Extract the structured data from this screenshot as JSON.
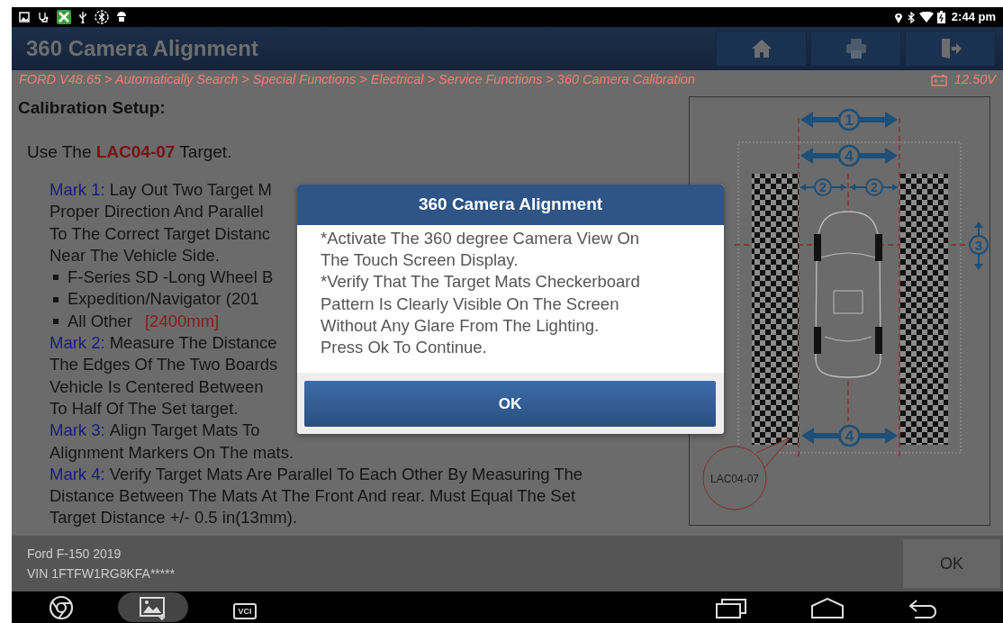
{
  "status_bar": {
    "time": "2:44 pm"
  },
  "header": {
    "title": "360 Camera Alignment",
    "buttons": [
      {
        "kind": "home"
      },
      {
        "kind": "print"
      },
      {
        "kind": "exit"
      }
    ]
  },
  "breadcrumb": {
    "path": "FORD V48.65 > Automatically Search > Special Functions > Electrical > Service Functions > 360 Camera Calibration",
    "voltage": "12.50V"
  },
  "content": {
    "heading": "Calibration Setup:",
    "intro": "Use The **LAC04-07** Target.",
    "lines": [
      {
        "kind": "mark",
        "label": "Mark 1:",
        "text": "Lay Out Two Target M"
      },
      {
        "kind": "text",
        "text": "Proper Direction And Parallel"
      },
      {
        "kind": "text",
        "text": "To The Correct Target Distanc"
      },
      {
        "kind": "text",
        "text": "Near The Vehicle Side."
      },
      {
        "kind": "bullet",
        "text": "F-Series SD -Long Wheel B"
      },
      {
        "kind": "bullet",
        "text": "Expedition/Navigator (201"
      },
      {
        "kind": "bullet",
        "text": "All Other",
        "value": "[2400mm]"
      },
      {
        "kind": "mark",
        "label": "Mark 2:",
        "text": "Measure The Distance"
      },
      {
        "kind": "text",
        "text": "The Edges Of The Two Boards"
      },
      {
        "kind": "text",
        "text": "Vehicle Is Centered Between"
      },
      {
        "kind": "text",
        "text": "To Half Of The Set target."
      },
      {
        "kind": "mark",
        "label": "Mark 3:",
        "text": "Align Target Mats To"
      },
      {
        "kind": "text",
        "text": "Alignment Markers On The mats."
      },
      {
        "kind": "mark",
        "label": "Mark 4:",
        "text": "Verify Target Mats Are Parallel To Each Other By Measuring The"
      },
      {
        "kind": "text",
        "text": "Distance Between The Mats At The Front And rear. Must Equal The Set"
      },
      {
        "kind": "text",
        "text": "Target Distance +/- 0.5 in(13mm)."
      }
    ]
  },
  "diagram": {
    "width_mark": "1",
    "outer_mark": "4",
    "half_marks": [
      "2",
      "2"
    ],
    "side_mark": "3",
    "rear_mark": "4",
    "target_label": "LAC04-07"
  },
  "dialog": {
    "title": "360 Camera Alignment",
    "lines": [
      "*Activate The 360 degree Camera View On",
      "The Touch Screen Display.",
      "*Verify That The Target Mats Checkerboard",
      "Pattern Is Clearly Visible On The Screen",
      "Without Any Glare From The Lighting.",
      "Press Ok To Continue."
    ],
    "button": "OK"
  },
  "footer": {
    "vehicle": "Ford F-150 2019",
    "vin": "VIN 1FTFW1RG8KFA*****",
    "button": "OK"
  },
  "nav_bar": {
    "apps": [
      {
        "kind": "browser",
        "selected": false
      },
      {
        "kind": "screenshot",
        "selected": true
      },
      {
        "kind": "vci",
        "label": "VCI",
        "selected": false
      }
    ]
  }
}
